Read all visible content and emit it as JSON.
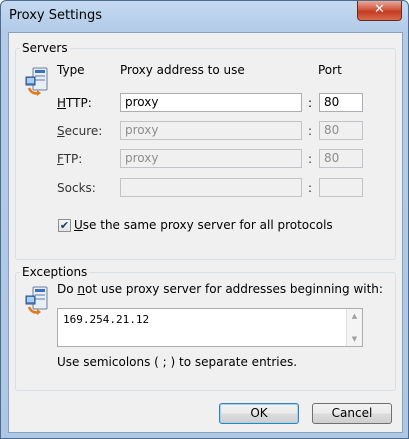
{
  "window": {
    "title": "Proxy Settings",
    "close_glyph": "✕"
  },
  "servers": {
    "group_label": "Servers",
    "col_type": "Type",
    "col_address": "Proxy address to use",
    "col_port": "Port",
    "rows": [
      {
        "key": "H",
        "rest": "TTP:",
        "address": "proxy",
        "port": "80",
        "enabled": true
      },
      {
        "key": "S",
        "rest": "ecure:",
        "address": "proxy",
        "port": "80",
        "enabled": false
      },
      {
        "key": "F",
        "rest": "TP:",
        "address": "proxy",
        "port": "80",
        "enabled": false
      },
      {
        "key": "Soc",
        "rest": "ks:",
        "address": "",
        "port": "",
        "enabled": false
      }
    ],
    "colon": ":",
    "same_proxy": {
      "key": "U",
      "rest": "se the same proxy server for all protocols",
      "checked": true,
      "check_glyph": "✔"
    }
  },
  "exceptions": {
    "group_label": "Exceptions",
    "desc_pre": "Do ",
    "desc_key": "n",
    "desc_post": "ot use proxy server for addresses beginning with:",
    "value": "169.254.21.12",
    "hint": "Use semicolons ( ; ) to separate entries."
  },
  "buttons": {
    "ok": "OK",
    "cancel": "Cancel"
  },
  "icons": {
    "network": "network-computer-icon",
    "exceptions": "network-computer-icon"
  }
}
